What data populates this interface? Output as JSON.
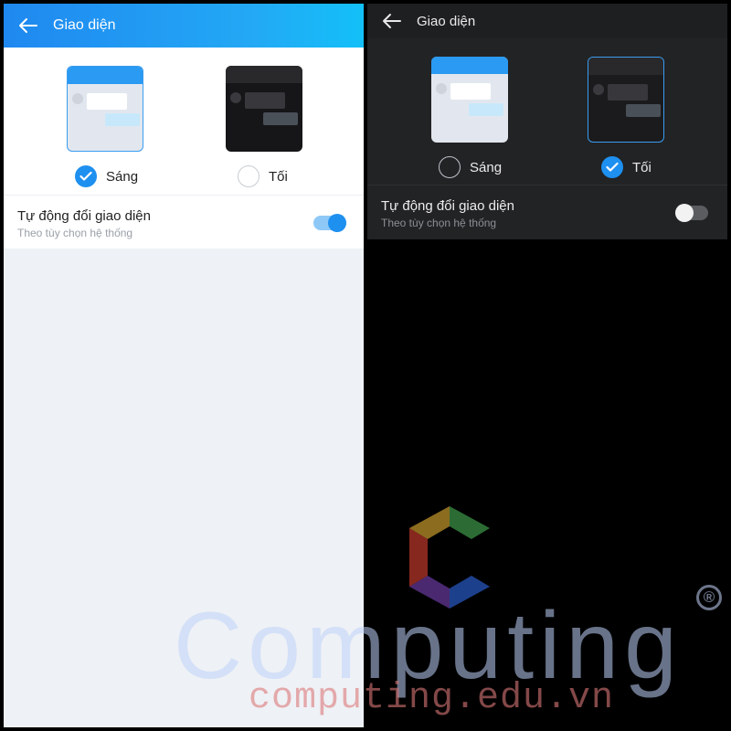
{
  "light": {
    "header_title": "Giao diện",
    "options": {
      "light_label": "Sáng",
      "dark_label": "Tối",
      "selected": "Sáng"
    },
    "auto_switch": {
      "title": "Tự động đổi giao diện",
      "subtitle": "Theo tùy chọn hệ thống",
      "enabled": true
    }
  },
  "dark": {
    "header_title": "Giao diện",
    "options": {
      "light_label": "Sáng",
      "dark_label": "Tối",
      "selected": "Tối"
    },
    "auto_switch": {
      "title": "Tự động đổi giao diện",
      "subtitle": "Theo tùy chọn hệ thống",
      "enabled": false
    }
  },
  "icons": [
    "back-arrow-icon",
    "checkmark-icon"
  ],
  "colors": {
    "accent": "#1e90f0",
    "light_header_start": "#1f88f0",
    "light_header_end": "#13c0f8",
    "dark_bg": "#222325"
  },
  "watermark": {
    "brand": "Computing",
    "registered": "®",
    "url": "computing.edu.vn"
  }
}
